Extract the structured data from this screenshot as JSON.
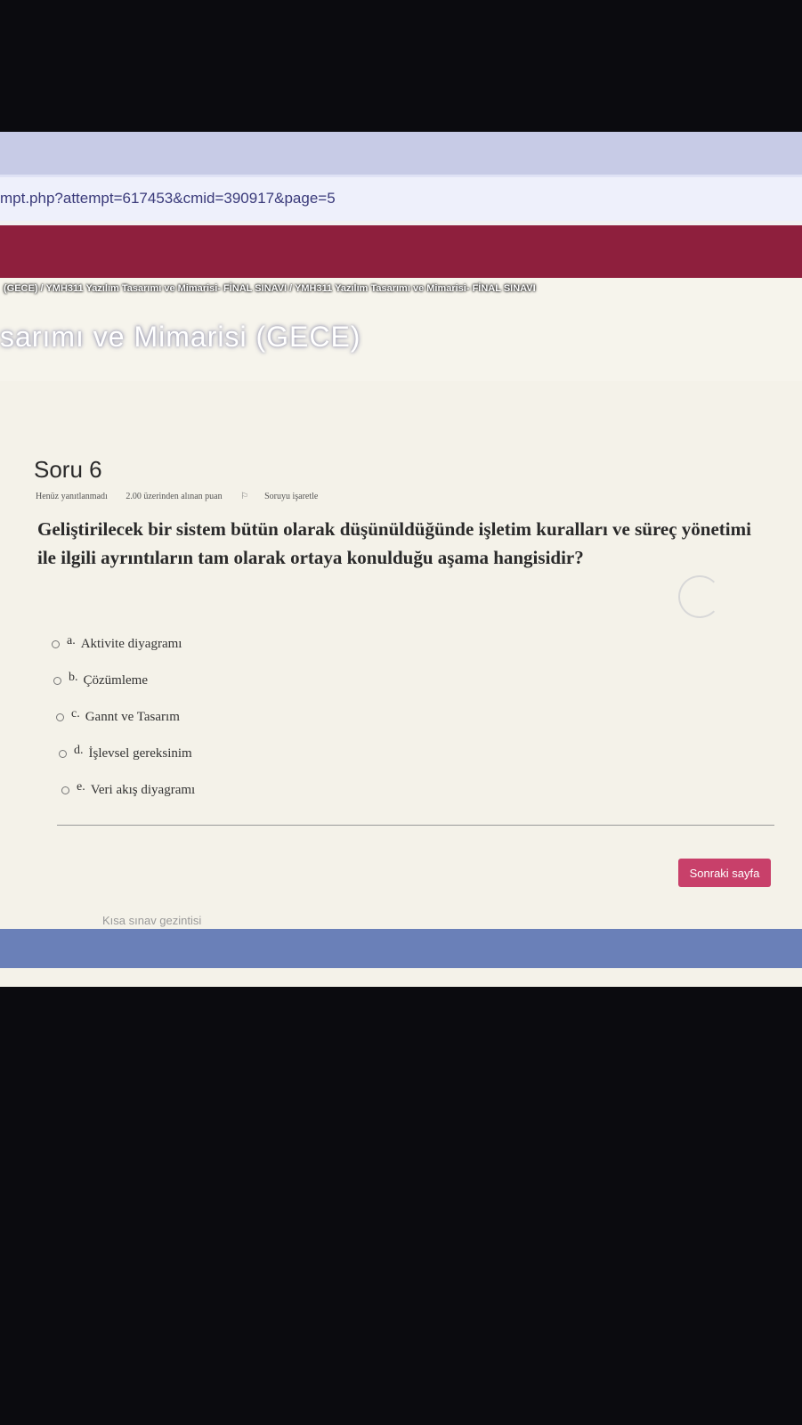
{
  "browser": {
    "url": "mpt.php?attempt=617453&cmid=390917&page=5"
  },
  "banner": {
    "breadcrumbs": "(GECE) / YMH311 Yazılım Tasarımı ve Mimarisi- FİNAL SINAVI / YMH311 Yazılım Tasarımı ve Mimarisi- FİNAL SINAVI",
    "course_title": "sarımı ve Mimarisi (GECE)"
  },
  "question": {
    "title": "Soru 6",
    "status": "Henüz yanıtlanmadı",
    "points": "2.00 üzerinden alınan puan",
    "flag_label": "Soruyu işaretle",
    "text": "Geliştirilecek bir sistem bütün olarak düşünüldüğünde işletim kuralları ve süreç yönetimi ile ilgili ayrıntıların tam olarak ortaya konulduğu aşama hangisidir?",
    "options": [
      {
        "letter": "a.",
        "label": "Aktivite diyagramı"
      },
      {
        "letter": "b.",
        "label": "Çözümleme"
      },
      {
        "letter": "c.",
        "label": "Gannt ve Tasarım"
      },
      {
        "letter": "d.",
        "label": "İşlevsel gereksinim"
      },
      {
        "letter": "e.",
        "label": "Veri akış diyagramı"
      }
    ]
  },
  "footer": {
    "next_label": "Sonraki sayfa",
    "nav_label": "Kısa sınav gezintisi"
  },
  "colors": {
    "brand_bar": "#8e1f3d",
    "next_button": "#c8406a"
  }
}
